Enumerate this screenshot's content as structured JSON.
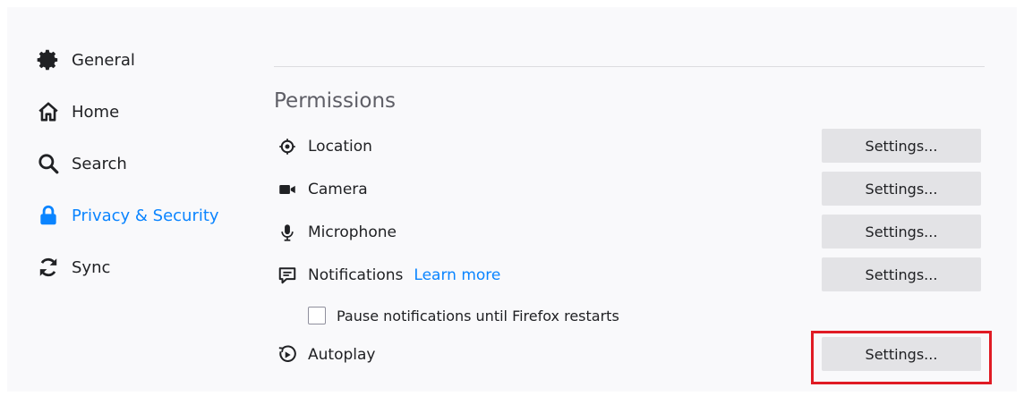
{
  "sidebar": {
    "items": [
      {
        "label": "General",
        "icon": "gear-icon",
        "active": false
      },
      {
        "label": "Home",
        "icon": "home-icon",
        "active": false
      },
      {
        "label": "Search",
        "icon": "search-icon",
        "active": false
      },
      {
        "label": "Privacy & Security",
        "icon": "lock-icon",
        "active": true
      },
      {
        "label": "Sync",
        "icon": "sync-icon",
        "active": false
      }
    ]
  },
  "permissions": {
    "title": "Permissions",
    "rows": [
      {
        "label": "Location",
        "icon": "location-icon",
        "button": "Settings..."
      },
      {
        "label": "Camera",
        "icon": "camera-icon",
        "button": "Settings..."
      },
      {
        "label": "Microphone",
        "icon": "microphone-icon",
        "button": "Settings..."
      },
      {
        "label": "Notifications",
        "icon": "notifications-icon",
        "button": "Settings...",
        "link": "Learn more"
      },
      {
        "label": "Autoplay",
        "icon": "autoplay-icon",
        "button": "Settings..."
      }
    ],
    "pause_notifications": {
      "label": "Pause notifications until Firefox restarts",
      "checked": false
    }
  },
  "colors": {
    "accent": "#0a84ff",
    "highlight": "#e01b24",
    "button_bg": "#e3e3e6"
  }
}
